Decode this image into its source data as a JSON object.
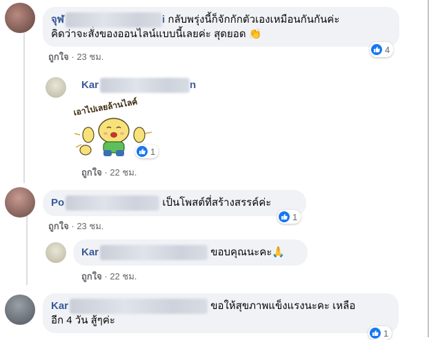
{
  "comments": [
    {
      "name_visible": "จุฬ",
      "name_suffix": "i",
      "text_line1": "กลับพรุ่งนี้ก็จักกักตัวเองเหมือนกันกันค่ะ",
      "text_line2": "คิดว่าจะสั่งของออนไลน์แบบนี้เลยค่ะ สุดยอด",
      "emoji": "👏",
      "like_label": "ถูกใจ",
      "time": "23 ชม.",
      "reaction_count": "4"
    },
    {
      "name_visible": "Kar",
      "name_suffix": "n",
      "sticker_text": "เอาไปเลยล้านไลค์",
      "like_label": "ถูกใจ",
      "time": "22 ชม.",
      "reaction_count": "1"
    },
    {
      "name_visible": "Po",
      "text": "เป็นโพสต์ที่สร้างสรรค์ค่ะ",
      "like_label": "ถูกใจ",
      "time": "23 ชม.",
      "reaction_count": "1"
    },
    {
      "name_visible": "Kar",
      "text": "ขอบคุณนะคะ",
      "emoji": "🙏",
      "like_label": "ถูกใจ",
      "time": "22 ชม."
    },
    {
      "name_visible": "Kar",
      "text_line1": "ขอให้สุขภาพแข็งแรงนะคะ เหลือ",
      "text_line2": "อีก 4 วัน สู้ๆค่ะ",
      "reaction_count": "1"
    }
  ],
  "separator": "·",
  "colors": {
    "accent": "#385898",
    "bubble": "#f0f2f5",
    "like_blue": "#1877f2"
  }
}
